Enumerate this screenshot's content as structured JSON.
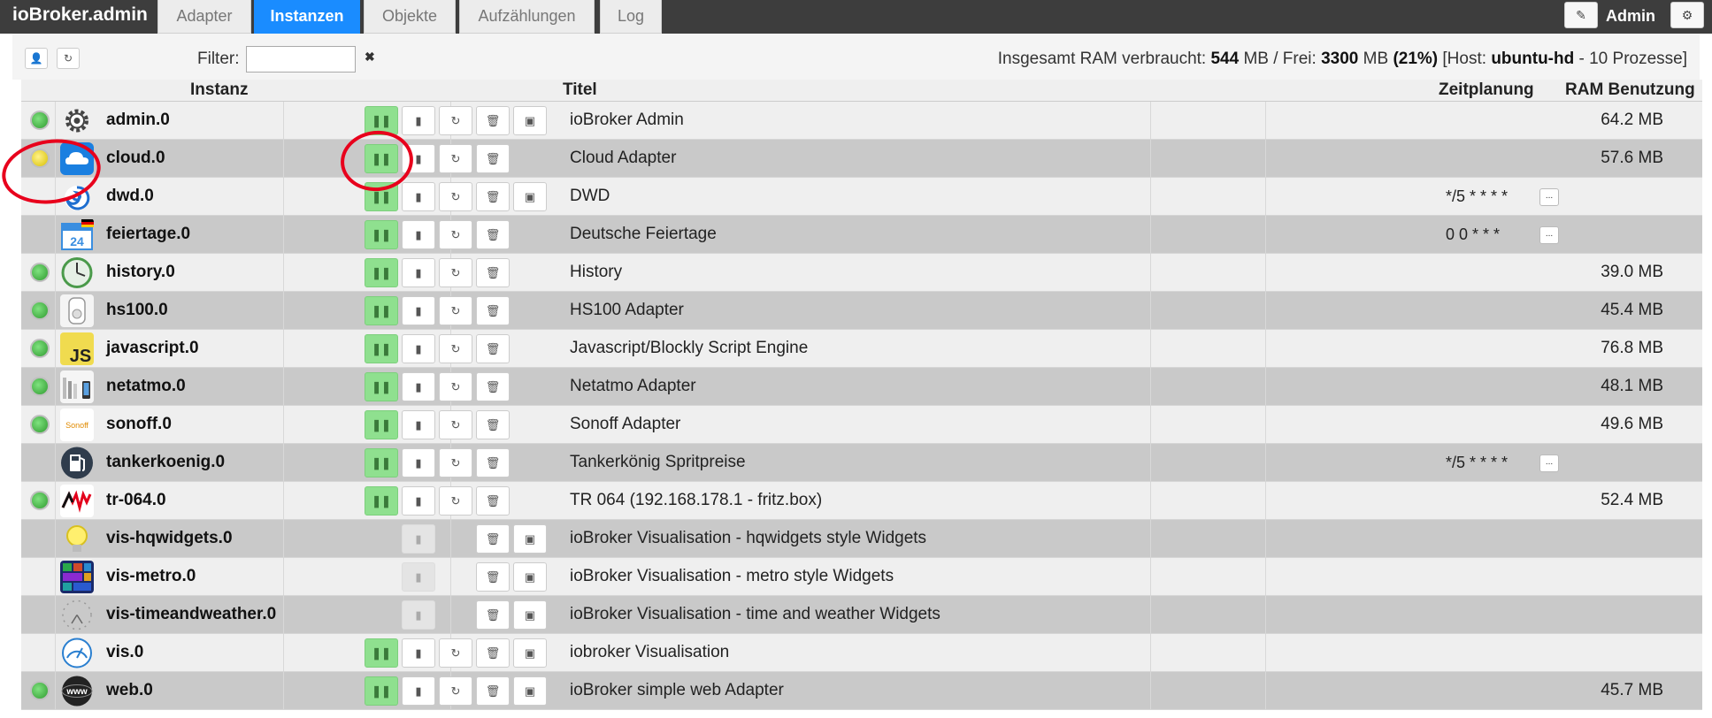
{
  "header": {
    "brand": "ioBroker.admin",
    "tabs": [
      {
        "label": "Adapter",
        "active": false
      },
      {
        "label": "Instanzen",
        "active": true
      },
      {
        "label": "Objekte",
        "active": false
      },
      {
        "label": "Aufzählungen",
        "active": false
      },
      {
        "label": "Log",
        "active": false
      }
    ],
    "user": "Admin"
  },
  "toolbar": {
    "filter_label": "Filter:",
    "filter_value": "",
    "filter_clear": "✖",
    "ram_prefix": "Insgesamt RAM verbraucht: ",
    "ram_used": "544",
    "ram_mid": " MB / Frei: ",
    "ram_free": "3300",
    "ram_mb": " MB ",
    "ram_percent": "(21%)",
    "host_prefix": " [Host: ",
    "host_name": "ubuntu-hd",
    "host_suffix": " - 10 Prozesse]"
  },
  "columns": {
    "instance": "Instanz",
    "title": "Titel",
    "schedule": "Zeitplanung",
    "ram": "RAM Benutzung"
  },
  "colors": {
    "active_tab": "#1a8cff",
    "status_green": "#3cb83c",
    "status_yellow": "#e6d400",
    "play_button": "#8fe08f",
    "annotation": "#e8001c"
  },
  "instances": [
    {
      "name": "admin.0",
      "title": "ioBroker Admin",
      "schedule": "",
      "ram": "64.2 MB",
      "status": "green",
      "icon": "gear-icon"
    },
    {
      "name": "cloud.0",
      "title": "Cloud Adapter",
      "schedule": "",
      "ram": "57.6 MB",
      "status": "yellow",
      "icon": "cloud-icon"
    },
    {
      "name": "dwd.0",
      "title": "DWD",
      "schedule": "*/5 * * * *",
      "ram": "",
      "status": "none",
      "icon": "weather-swirl-icon"
    },
    {
      "name": "feiertage.0",
      "title": "Deutsche Feiertage",
      "schedule": "0 0 * * *",
      "ram": "",
      "status": "none",
      "icon": "calendar-icon",
      "icon_text": "24"
    },
    {
      "name": "history.0",
      "title": "History",
      "schedule": "",
      "ram": "39.0 MB",
      "status": "green",
      "icon": "clock-icon"
    },
    {
      "name": "hs100.0",
      "title": "HS100 Adapter",
      "schedule": "",
      "ram": "45.4 MB",
      "status": "green",
      "icon": "smart-plug-icon"
    },
    {
      "name": "javascript.0",
      "title": "Javascript/Blockly Script Engine",
      "schedule": "",
      "ram": "76.8 MB",
      "status": "green",
      "icon": "javascript-icon",
      "icon_text": "JS"
    },
    {
      "name": "netatmo.0",
      "title": "Netatmo Adapter",
      "schedule": "",
      "ram": "48.1 MB",
      "status": "green",
      "icon": "netatmo-icon"
    },
    {
      "name": "sonoff.0",
      "title": "Sonoff Adapter",
      "schedule": "",
      "ram": "49.6 MB",
      "status": "green",
      "icon": "sonoff-icon",
      "icon_text": "Sonoff"
    },
    {
      "name": "tankerkoenig.0",
      "title": "Tankerkönig Spritpreise",
      "schedule": "*/5 * * * *",
      "ram": "",
      "status": "none",
      "icon": "fuel-pump-icon"
    },
    {
      "name": "tr-064.0",
      "title": "TR 064 (192.168.178.1 - fritz.box)",
      "schedule": "",
      "ram": "52.4 MB",
      "status": "green",
      "icon": "avm-icon",
      "icon_text": "AVM"
    },
    {
      "name": "vis-hqwidgets.0",
      "title": "ioBroker Visualisation - hqwidgets style Widgets",
      "schedule": "",
      "ram": "",
      "status": "none",
      "icon": "lightbulb-icon"
    },
    {
      "name": "vis-metro.0",
      "title": "ioBroker Visualisation - metro style Widgets",
      "schedule": "",
      "ram": "",
      "status": "none",
      "icon": "metro-tiles-icon"
    },
    {
      "name": "vis-timeandweather.0",
      "title": "ioBroker Visualisation - time and weather Widgets",
      "schedule": "",
      "ram": "",
      "status": "none",
      "icon": "clock-face-icon"
    },
    {
      "name": "vis.0",
      "title": "iobroker Visualisation",
      "schedule": "",
      "ram": "",
      "status": "none",
      "icon": "gauge-icon"
    },
    {
      "name": "web.0",
      "title": "ioBroker simple web Adapter",
      "schedule": "",
      "ram": "45.7 MB",
      "status": "green",
      "icon": "globe-www-icon",
      "icon_text": "www"
    }
  ]
}
